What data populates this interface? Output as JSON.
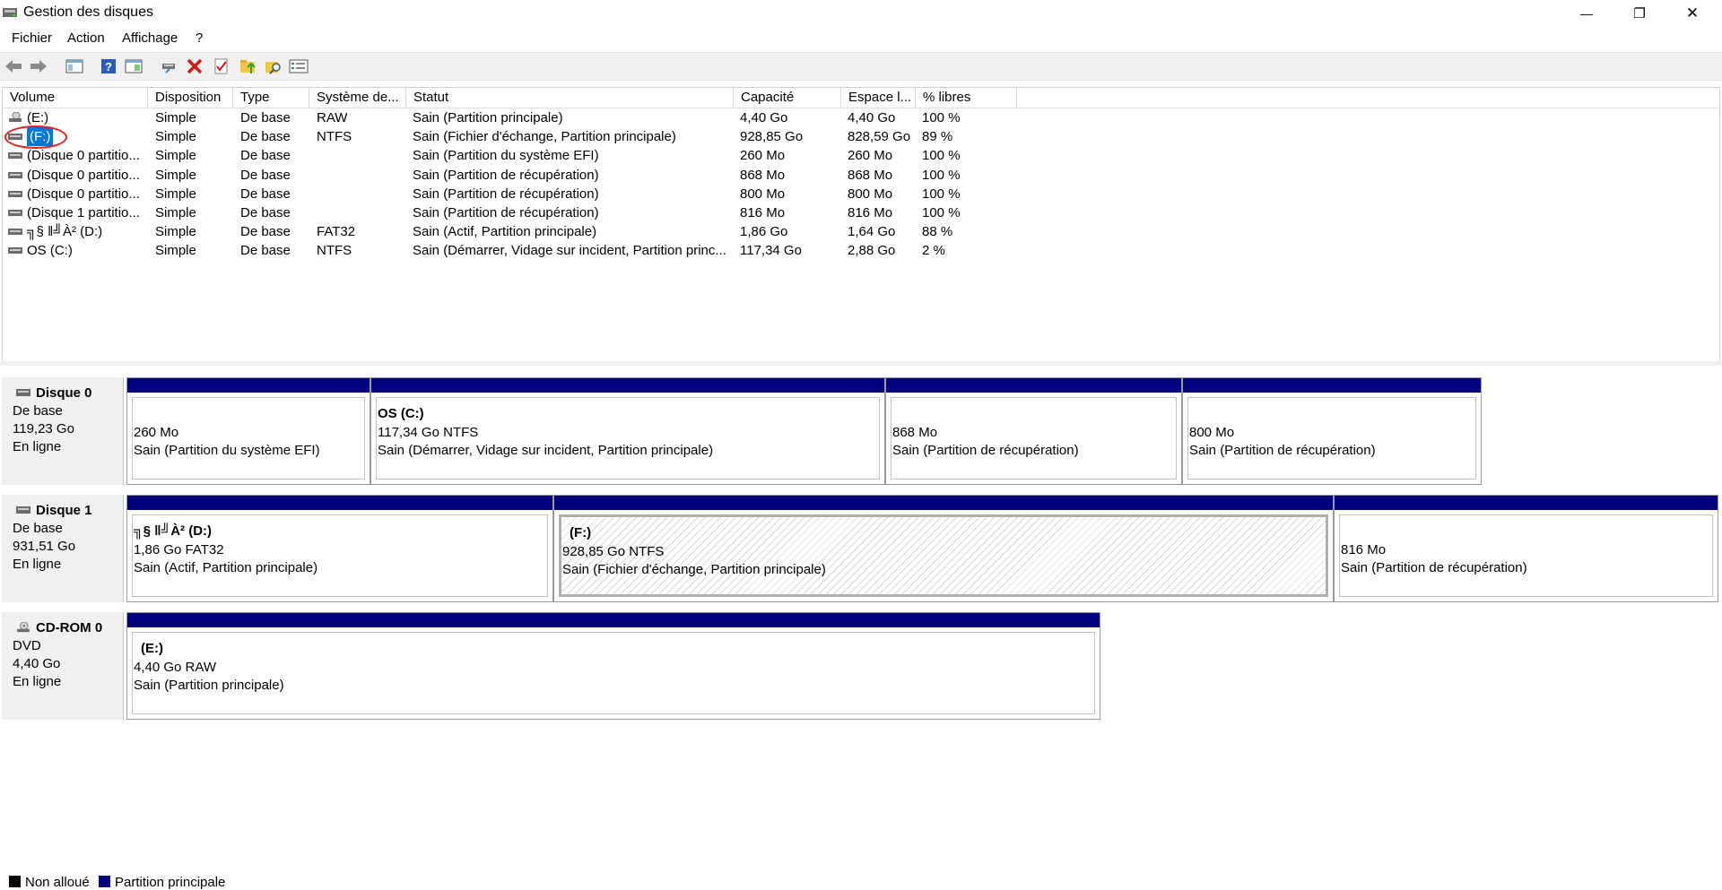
{
  "window": {
    "title": "Gestion des disques",
    "minimize_glyph": "—",
    "maximize_glyph": "❐",
    "close_glyph": "✕"
  },
  "menu": {
    "items": [
      "Fichier",
      "Action",
      "Affichage",
      "?"
    ]
  },
  "toolbar": {
    "icons": [
      "back-icon",
      "forward-icon",
      "console-tree-icon",
      "help-icon",
      "properties-pane-icon",
      "connect-disk-icon",
      "delete-icon",
      "check-icon",
      "folder-up-icon",
      "search-folder-icon",
      "list-view-icon"
    ]
  },
  "volumes": {
    "columns": [
      "Volume",
      "Disposition",
      "Type",
      "Système de...",
      "Statut",
      "Capacité",
      "Espace l...",
      "% libres"
    ],
    "rows": [
      {
        "volume": "(E:)",
        "disposition": "Simple",
        "type": "De base",
        "fs": "RAW",
        "status": "Sain (Partition principale)",
        "capacity": "4,40 Go",
        "free": "4,40 Go",
        "pct": "100 %"
      },
      {
        "volume": "(F:)",
        "disposition": "Simple",
        "type": "De base",
        "fs": "NTFS",
        "status": "Sain (Fichier d'échange, Partition principale)",
        "capacity": "928,85 Go",
        "free": "828,59 Go",
        "pct": "89 %"
      },
      {
        "volume": "(Disque 0 partitio...",
        "disposition": "Simple",
        "type": "De base",
        "fs": "",
        "status": "Sain (Partition du système EFI)",
        "capacity": "260 Mo",
        "free": "260 Mo",
        "pct": "100 %"
      },
      {
        "volume": "(Disque 0 partitio...",
        "disposition": "Simple",
        "type": "De base",
        "fs": "",
        "status": "Sain (Partition de récupération)",
        "capacity": "868 Mo",
        "free": "868 Mo",
        "pct": "100 %"
      },
      {
        "volume": "(Disque 0 partitio...",
        "disposition": "Simple",
        "type": "De base",
        "fs": "",
        "status": "Sain (Partition de récupération)",
        "capacity": "800 Mo",
        "free": "800 Mo",
        "pct": "100 %"
      },
      {
        "volume": "(Disque 1 partitio...",
        "disposition": "Simple",
        "type": "De base",
        "fs": "",
        "status": "Sain (Partition de récupération)",
        "capacity": "816 Mo",
        "free": "816 Mo",
        "pct": "100 %"
      },
      {
        "volume": "╗§ ‖╝À² (D:)",
        "disposition": "Simple",
        "type": "De base",
        "fs": "FAT32",
        "status": "Sain (Actif, Partition principale)",
        "capacity": "1,86 Go",
        "free": "1,64 Go",
        "pct": "88 %"
      },
      {
        "volume": "OS (C:)",
        "disposition": "Simple",
        "type": "De base",
        "fs": "NTFS",
        "status": "Sain (Démarrer, Vidage sur incident, Partition princ...",
        "capacity": "117,34 Go",
        "free": "2,88 Go",
        "pct": "2 %"
      }
    ]
  },
  "disks": [
    {
      "name": "Disque 0",
      "kind": "De base",
      "size": "119,23 Go",
      "state": "En ligne",
      "partitions": [
        {
          "title": "",
          "line1": "260 Mo",
          "line2": "Sain (Partition du système EFI)"
        },
        {
          "title": "OS  (C:)",
          "line1": "117,34 Go NTFS",
          "line2": "Sain (Démarrer, Vidage sur incident, Partition principale)"
        },
        {
          "title": "",
          "line1": "868 Mo",
          "line2": "Sain (Partition de récupération)"
        },
        {
          "title": "",
          "line1": "800 Mo",
          "line2": "Sain (Partition de récupération)"
        }
      ]
    },
    {
      "name": "Disque 1",
      "kind": "De base",
      "size": "931,51 Go",
      "state": "En ligne",
      "partitions": [
        {
          "title": "╗§ ‖╝À²  (D:)",
          "line1": "1,86 Go FAT32",
          "line2": "Sain (Actif, Partition principale)"
        },
        {
          "title": "(F:)",
          "line1": "928,85 Go NTFS",
          "line2": "Sain (Fichier d'échange, Partition principale)"
        },
        {
          "title": "",
          "line1": "816 Mo",
          "line2": "Sain (Partition de récupération)"
        }
      ]
    },
    {
      "name": "CD-ROM 0",
      "kind": "DVD",
      "size": "4,40 Go",
      "state": "En ligne",
      "partitions": [
        {
          "title": "(E:)",
          "line1": "4,40 Go RAW",
          "line2": "Sain (Partition principale)"
        }
      ]
    }
  ],
  "legend": {
    "unallocated": "Non alloué",
    "primary": "Partition principale"
  },
  "colors": {
    "partition_bar": "#00007f",
    "selection": "#0078d7",
    "annotation": "#e2201c"
  }
}
